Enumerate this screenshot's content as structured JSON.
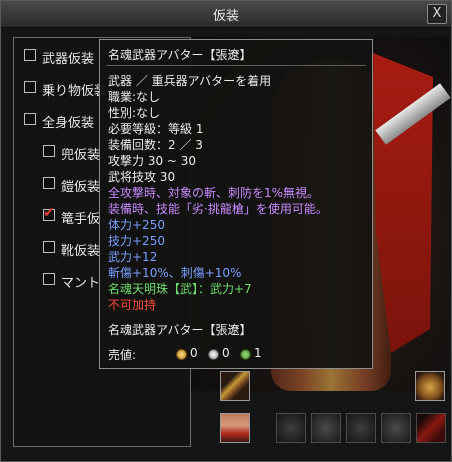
{
  "window": {
    "title": "仮装",
    "close_glyph": "X"
  },
  "options": [
    {
      "label": "武器仮装",
      "checked": false
    },
    {
      "label": "乗り物仮装",
      "checked": false
    },
    {
      "label": "全身仮装",
      "checked": false
    },
    {
      "label": "兜仮装",
      "checked": false
    },
    {
      "label": "鎧仮装",
      "checked": false
    },
    {
      "label": "篭手仮",
      "checked": true
    },
    {
      "label": "靴仮装",
      "checked": false
    },
    {
      "label": "マント",
      "checked": false
    }
  ],
  "tooltip": {
    "name": "名魂武器アバター【張遼】",
    "type": "武器 ／ 重兵器アバターを着用",
    "job": "職業:なし",
    "gender": "性別:なし",
    "level": "必要等級：等級 1",
    "equip_count": "装備回数：2 ／ 3",
    "attack": "攻撃力 30 ~ 30",
    "skill": "武将技攻 30",
    "effect1": "全攻撃時、対象の斬、刺防を1%無視。",
    "effect2": "装備時、技能「劣·挑龍槍」を使用可能。",
    "stat1": "体力+250",
    "stat2": "技力+250",
    "stat3": "武力+12",
    "stat4": "斬傷+10%、刺傷+10%",
    "gem": "名魂天明珠【武】：武力+7",
    "no_upgrade": "不可加持",
    "footer_name": "名魂武器アバター【張遼】",
    "price_label": "売値:",
    "price_gold": "0",
    "price_silver": "0",
    "price_copper": "1"
  },
  "slots": [
    {
      "icon": "weapon-slot-icon"
    },
    {
      "icon": "helmet-slot-icon"
    },
    {
      "icon": "armor-slot-icon"
    },
    {
      "icon": "glove-slot-icon"
    },
    {
      "icon": "shoulder-slot-icon"
    },
    {
      "icon": "boots-slot-icon"
    },
    {
      "icon": "gauntlet-slot-icon"
    },
    {
      "icon": "cape-slot-icon"
    }
  ]
}
